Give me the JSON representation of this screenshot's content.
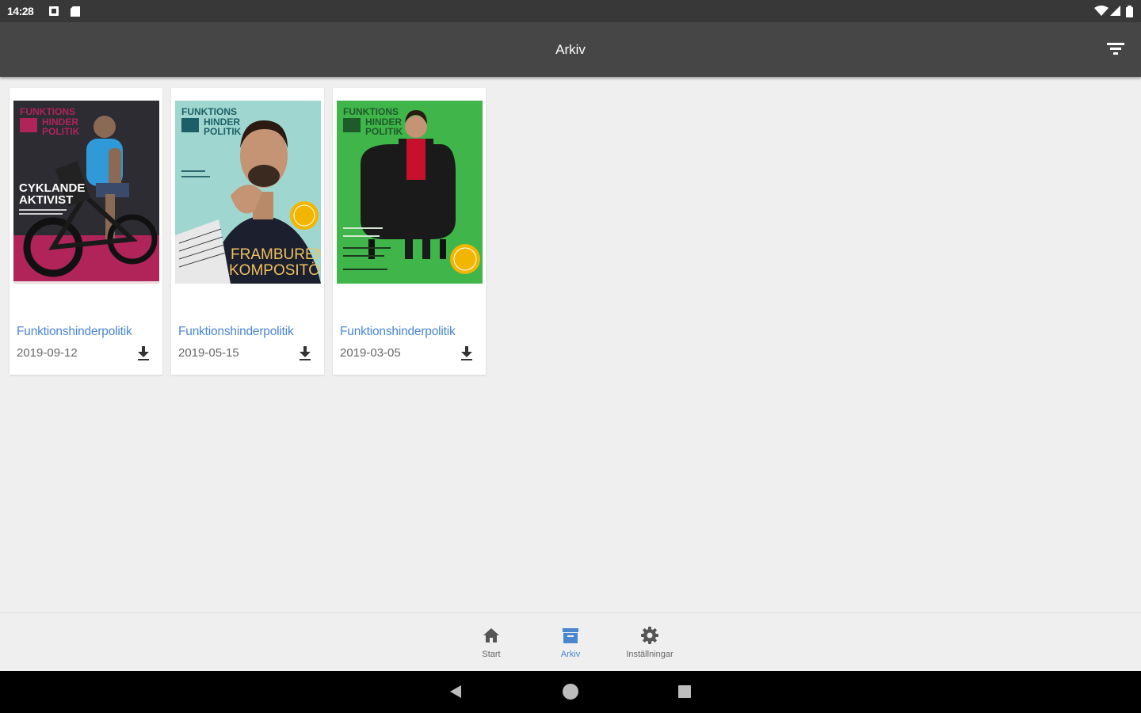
{
  "status_bar": {
    "time": "14:28"
  },
  "app_bar": {
    "title": "Arkiv",
    "filter_icon": "filter-icon"
  },
  "archive": {
    "issues": [
      {
        "title": "Funktionshinderpolitik",
        "date": "2019-09-12",
        "cover": {
          "masthead": [
            "FUNKTIONS",
            "HINDER",
            "POLITIK"
          ],
          "headline": [
            "CYKLANDE",
            "AKTIVIST"
          ],
          "colors": {
            "bg": "#2e2c33",
            "floor": "#b0245a",
            "masthead": "#b0245a",
            "shirt": "#2f9ad7",
            "text": "#ffffff"
          }
        }
      },
      {
        "title": "Funktionshinderpolitik",
        "date": "2019-05-15",
        "cover": {
          "masthead": [
            "FUNKTIONS",
            "HINDER",
            "POLITIK"
          ],
          "headline": [
            "FRAMBUREN",
            "KOMPOSITÖR"
          ],
          "colors": {
            "bg": "#9fd7d0",
            "masthead": "#1d5f66",
            "jacket": "#1b1f2e",
            "badge": "#f2b600",
            "text": "#f0c060"
          }
        }
      },
      {
        "title": "Funktionshinderpolitik",
        "date": "2019-03-05",
        "cover": {
          "masthead": [
            "FUNKTIONS",
            "HINDER",
            "POLITIK"
          ],
          "headline": [],
          "colors": {
            "bg": "#3fb54a",
            "masthead": "#1e5a2a",
            "chair": "#1a1a1a",
            "shirt": "#c8102e",
            "badge": "#f2b600"
          }
        }
      }
    ],
    "download_icon": "download-icon"
  },
  "bottom_nav": {
    "items": [
      {
        "label": "Start",
        "icon": "home-icon",
        "active": false
      },
      {
        "label": "Arkiv",
        "icon": "archive-icon",
        "active": true
      },
      {
        "label": "Inställningar",
        "icon": "gear-icon",
        "active": false
      }
    ],
    "active_color": "#4a86d0"
  },
  "system_nav": {
    "back": "back-icon",
    "home": "home-circle-icon",
    "recents": "recents-icon"
  }
}
